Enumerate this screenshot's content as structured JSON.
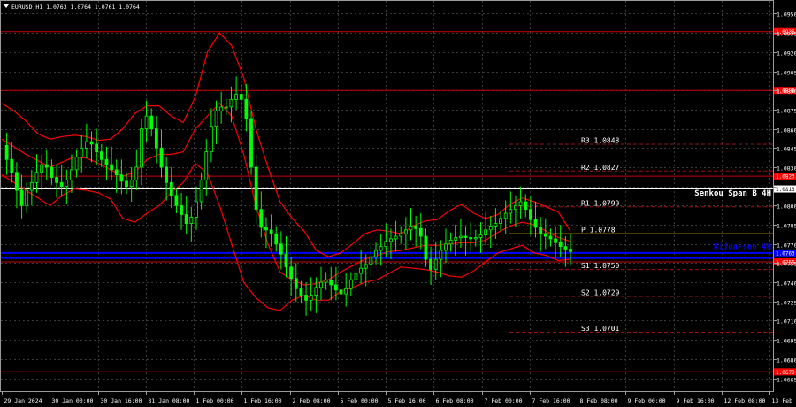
{
  "header": {
    "symbol_line": "EURUSD,H1  1.0763 1.0764 1.0761 1.0764"
  },
  "colors": {
    "background": "#000000",
    "grid": "#3a3a3a",
    "candle": "#00ff00",
    "bands": "#ff0000",
    "level_red": "#cc0000",
    "pivot_dashed": "#a01010",
    "pivot_line": "#c8a000",
    "kijun": "#0000ff",
    "senkou": "#ffffff",
    "price_label_red": "#ff0000",
    "price_label_white": "#ffffff",
    "price_label_blue": "#0000ff"
  },
  "chart_data": {
    "type": "candlestick",
    "y_range": [
      1.0655,
      1.096
    ],
    "y_ticks": [
      "1.0950",
      "1.0935",
      "1.0920",
      "1.0905",
      "1.0890",
      "1.0875",
      "1.0860",
      "1.0845",
      "1.0830",
      "1.0815",
      "1.0800",
      "1.0785",
      "1.0770",
      "1.0755",
      "1.0740",
      "1.0725",
      "1.0710",
      "1.0695",
      "1.0680",
      "1.0665"
    ],
    "x_ticks": [
      "29 Jan 2024",
      "30 Jan 00:00",
      "30 Jan 16:00",
      "31 Jan 08:00",
      "1 Feb 00:00",
      "1 Feb 16:00",
      "2 Feb 08:00",
      "5 Feb 00:00",
      "5 Feb 16:00",
      "6 Feb 08:00",
      "7 Feb 00:00",
      "7 Feb 16:00",
      "8 Feb 08:00",
      "9 Feb 00:00",
      "9 Feb 16:00",
      "12 Feb 08:00",
      "13 Feb 00:00"
    ],
    "close_series": [
      1.0847,
      1.0836,
      1.0826,
      1.0812,
      1.08,
      1.0812,
      1.0818,
      1.0826,
      1.0832,
      1.083,
      1.0822,
      1.0818,
      1.0815,
      1.082,
      1.0828,
      1.0838,
      1.0845,
      1.085,
      1.0848,
      1.0842,
      1.0836,
      1.0832,
      1.0828,
      1.0824,
      1.0819,
      1.0815,
      1.082,
      1.083,
      1.086,
      1.087,
      1.086,
      1.0845,
      1.083,
      1.0818,
      1.0808,
      1.08,
      1.0793,
      1.0786,
      1.0791,
      1.0803,
      1.082,
      1.0842,
      1.0862,
      1.0874,
      1.0877,
      1.0877,
      1.0883,
      1.0887,
      1.0883,
      1.0868,
      1.083,
      1.0797,
      1.0783,
      1.0781,
      1.0778,
      1.077,
      1.0762,
      1.0752,
      1.0743,
      1.0735,
      1.073,
      1.0726,
      1.073,
      1.0736,
      1.074,
      1.0742,
      1.0738,
      1.0734,
      1.0731,
      1.0735,
      1.0742,
      1.0747,
      1.0751,
      1.0754,
      1.076,
      1.0765,
      1.0768,
      1.0772,
      1.0774,
      1.0776,
      1.0778,
      1.0781,
      1.0784,
      1.0782,
      1.0776,
      1.0758,
      1.075,
      1.0758,
      1.0765,
      1.077,
      1.0773,
      1.0775,
      1.0776,
      1.0775,
      1.0774,
      1.0775,
      1.0777,
      1.0781,
      1.0784,
      1.0786,
      1.079,
      1.0794,
      1.0797,
      1.08,
      1.0803,
      1.0797,
      1.0789,
      1.0783,
      1.0778,
      1.0776,
      1.0774,
      1.0771,
      1.0768,
      1.0766,
      1.0764
    ],
    "bands": {
      "upper": [
        1.088,
        1.0874,
        1.0866,
        1.0856,
        1.0852,
        1.0854,
        1.0855,
        1.0854,
        1.0851,
        1.0852,
        1.086,
        1.0872,
        1.0878,
        1.0878,
        1.087,
        1.0865,
        1.0885,
        1.092,
        1.0935,
        1.0925,
        1.09,
        1.086,
        1.083,
        1.0803,
        1.079,
        1.078,
        1.0765,
        1.076,
        1.0763,
        1.077,
        1.0778,
        1.0781,
        1.078,
        1.0778,
        1.0784,
        1.0788,
        1.0789,
        1.0796,
        1.0801,
        1.0794,
        1.079,
        1.0793,
        1.0801,
        1.0806,
        1.0803,
        1.0799,
        1.0795,
        1.078
      ],
      "middle": [
        1.0852,
        1.0846,
        1.084,
        1.0835,
        1.083,
        1.0834,
        1.0838,
        1.0837,
        1.0833,
        1.0828,
        1.0823,
        1.0826,
        1.0836,
        1.084,
        1.084,
        1.0842,
        1.086,
        1.087,
        1.088,
        1.087,
        1.084,
        1.08,
        1.077,
        1.0748,
        1.0742,
        1.0738,
        1.0739,
        1.0742,
        1.0748,
        1.0753,
        1.0758,
        1.0761,
        1.0764,
        1.0765,
        1.0767,
        1.0769,
        1.0769,
        1.077,
        1.0771,
        1.0771,
        1.0773,
        1.0779,
        1.0784,
        1.0787,
        1.0785,
        1.078,
        1.0775,
        1.0772
      ],
      "lower": [
        1.0824,
        1.0818,
        1.0812,
        1.0806,
        1.08,
        1.0808,
        1.0813,
        1.0812,
        1.081,
        1.0805,
        1.079,
        1.0787,
        1.0794,
        1.08,
        1.081,
        1.0818,
        1.0833,
        1.0825,
        1.08,
        1.077,
        1.074,
        1.0728,
        1.072,
        1.0718,
        1.0726,
        1.073,
        1.0726,
        1.0726,
        1.0733,
        1.0736,
        1.074,
        1.0742,
        1.0747,
        1.0752,
        1.0751,
        1.075,
        1.0748,
        1.0745,
        1.0744,
        1.0749,
        1.0756,
        1.0763,
        1.0766,
        1.0769,
        1.0763,
        1.0761,
        1.0757,
        1.0758
      ]
    },
    "horizontal_levels": [
      {
        "price": 1.0936,
        "style": "solid",
        "color": "#cc0000",
        "label": "1.0936"
      },
      {
        "price": 1.089,
        "style": "solid",
        "color": "#cc0000",
        "label": "1.0888"
      },
      {
        "price": 1.0823,
        "style": "solid",
        "color": "#cc0000",
        "label": "1.0823"
      },
      {
        "price": 1.0813,
        "style": "solid",
        "color": "#ffffff",
        "label": "1.0813"
      },
      {
        "price": 1.0763,
        "style": "solid",
        "color": "#0000ff",
        "label": "1.0763"
      },
      {
        "price": 1.0759,
        "style": "solid",
        "color": "#0000ff",
        "label": ""
      },
      {
        "price": 1.0756,
        "style": "solid",
        "color": "#cc0000",
        "label": "1.0756"
      },
      {
        "price": 1.067,
        "style": "solid",
        "color": "#cc0000",
        "label": "1.0670"
      }
    ],
    "pivot_levels": [
      {
        "name": "R3",
        "value": "1.0848",
        "price": 1.0848
      },
      {
        "name": "R2",
        "value": "1.0827",
        "price": 1.0827
      },
      {
        "name": "R1",
        "value": "1.0799",
        "price": 1.0799
      },
      {
        "name": "P",
        "value": "1.0778",
        "price": 1.0778
      },
      {
        "name": "S1",
        "value": "1.0750",
        "price": 1.075
      },
      {
        "name": "S2",
        "value": "1.0729",
        "price": 1.0729
      },
      {
        "name": "S3",
        "value": "1.0701",
        "price": 1.0701
      }
    ],
    "annotations": [
      {
        "text": "Senkou Span B 4H",
        "price": 1.0808,
        "color": "#ffffff"
      },
      {
        "text": "Kijun-sen 4H",
        "price": 1.0766,
        "color": "#0000ff"
      }
    ]
  }
}
